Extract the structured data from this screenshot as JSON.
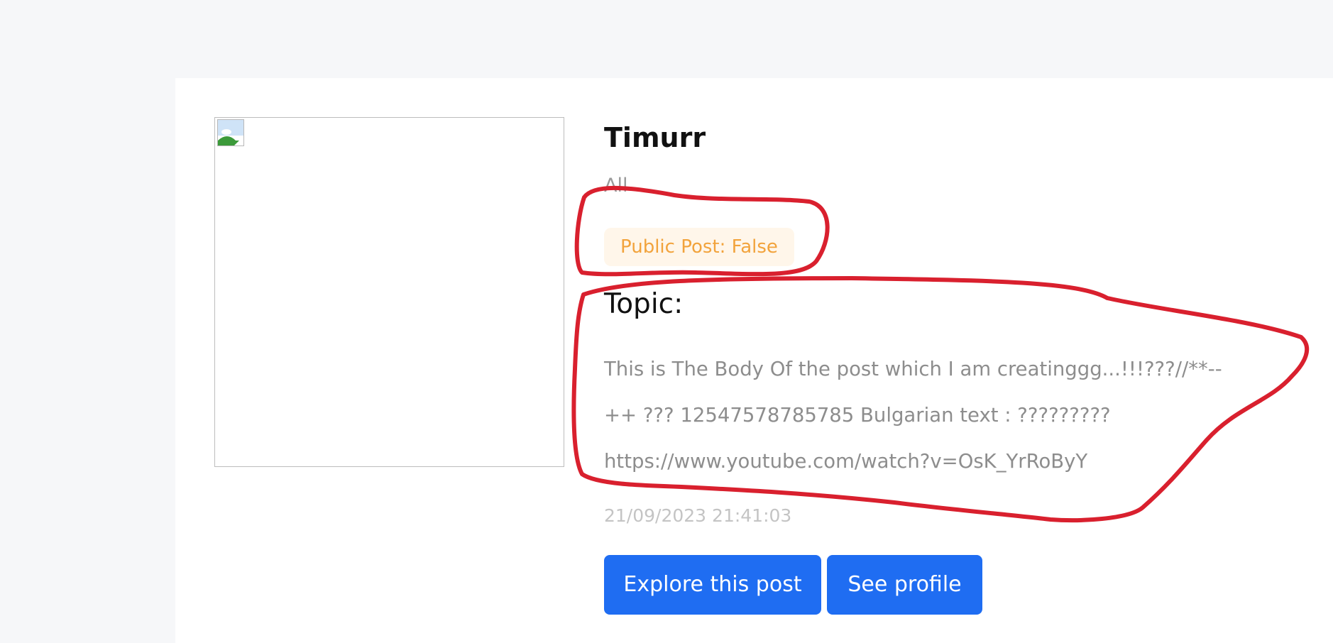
{
  "post": {
    "author": "Timurr",
    "category": "All",
    "visibility_badge": "Public Post: False",
    "topic_label": "Topic:",
    "body_lines": [
      "This is The Body Of the post which I am creatinggg...!!!???//**--",
      "++ ??? 12547578785785 Bulgarian text : ?????????",
      "https://www.youtube.com/watch?v=OsK_YrRoByY"
    ],
    "timestamp": "21/09/2023 21:41:03",
    "thumbnail_icon": "broken-image-icon"
  },
  "actions": {
    "explore_label": "Explore this post",
    "profile_label": "See profile"
  },
  "colors": {
    "page_background": "#f6f7f9",
    "card_background": "#ffffff",
    "badge_text": "#f2a33c",
    "badge_background": "#fff6ea",
    "button": "#1f6df2",
    "annotation_stroke": "#d9202e"
  }
}
